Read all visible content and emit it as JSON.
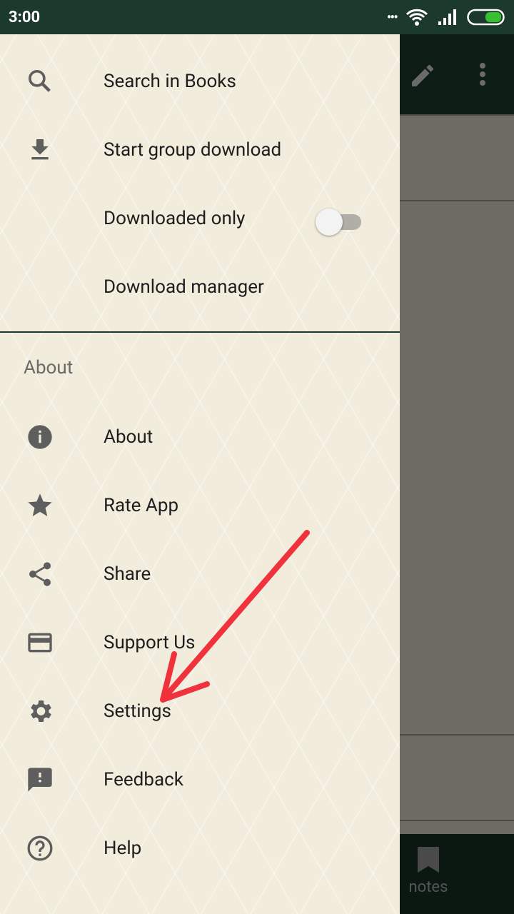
{
  "status_bar": {
    "time": "3:00",
    "battery_color": "#39c032"
  },
  "menu": {
    "items": [
      {
        "label": "Search in Books",
        "icon": "search-icon"
      },
      {
        "label": "Start group download",
        "icon": "download-icon"
      },
      {
        "label": "Downloaded only",
        "toggle": false
      },
      {
        "label": "Download manager"
      }
    ],
    "section_title": "About",
    "about_items": [
      {
        "label": "About",
        "icon": "info-icon"
      },
      {
        "label": "Rate App",
        "icon": "star-icon"
      },
      {
        "label": "Share",
        "icon": "share-icon"
      },
      {
        "label": "Support Us",
        "icon": "credit-card-icon"
      },
      {
        "label": "Settings",
        "icon": "gear-icon"
      },
      {
        "label": "Feedback",
        "icon": "feedback-icon"
      },
      {
        "label": "Help",
        "icon": "help-icon"
      }
    ]
  },
  "bottom_nav": {
    "notes_label": "notes"
  },
  "annotation": {
    "arrow_color": "#f0323c"
  }
}
